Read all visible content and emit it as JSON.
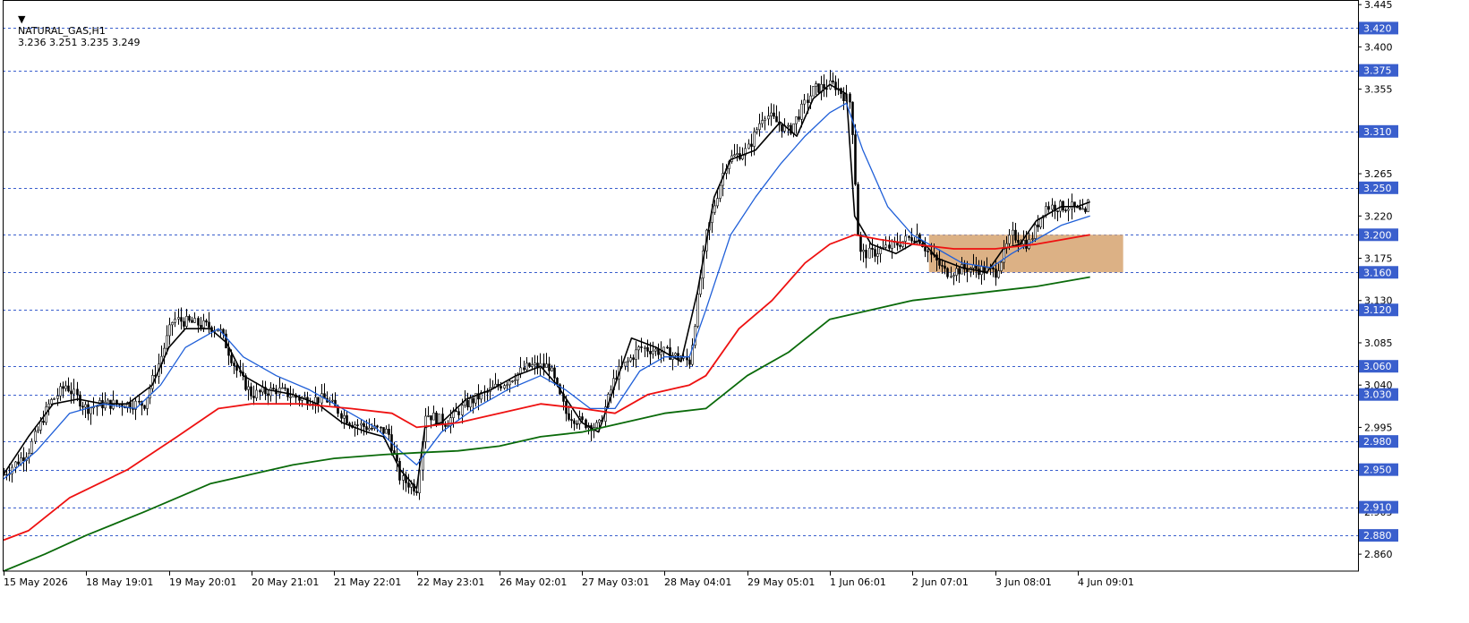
{
  "header": {
    "symbol": "NATURAL_GAS,H1",
    "ohlc": "3.236 3.251 3.235 3.249"
  },
  "colors": {
    "background": "#ffffff",
    "candles": "#000000",
    "ma_fast": "#000000",
    "ma_mid": "#1f5fd8",
    "ma_slow_red": "#ee1111",
    "ma_slowest_green": "#0a6a0a",
    "level_line": "#3a5fcd",
    "level_badge": "#3a5fcd",
    "zone_fill": "#d8a978"
  },
  "chart_data": {
    "type": "line",
    "title": "",
    "xlabel": "",
    "ylabel": "",
    "ylim": [
      2.842,
      3.448
    ],
    "y_ticks": [
      "3.445",
      "3.400",
      "3.355",
      "3.265",
      "3.220",
      "3.175",
      "3.130",
      "3.085",
      "3.040",
      "2.995",
      "2.905",
      "2.860"
    ],
    "x_ticks": [
      "15 May 2026",
      "18 May 19:01",
      "19 May 20:01",
      "20 May 21:01",
      "21 May 22:01",
      "22 May 23:01",
      "26 May 02:01",
      "27 May 03:01",
      "28 May 04:01",
      "29 May 05:01",
      "1 Jun 06:01",
      "2 Jun 07:01",
      "3 Jun 08:01",
      "4 Jun 09:01"
    ],
    "levels": [
      "3.420",
      "3.375",
      "3.310",
      "3.250",
      "3.200",
      "3.160",
      "3.120",
      "3.060",
      "3.030",
      "2.980",
      "2.950",
      "2.910",
      "2.880"
    ],
    "zone": {
      "top": 3.2,
      "bottom": 3.16,
      "x_start": 11.2,
      "x_end": 13.55
    },
    "candles_close_path": [
      [
        0,
        2.945
      ],
      [
        0.3,
        2.97
      ],
      [
        0.55,
        3.02
      ],
      [
        0.75,
        3.04
      ],
      [
        1.0,
        3.015
      ],
      [
        1.2,
        3.02
      ],
      [
        1.4,
        3.02
      ],
      [
        1.7,
        3.02
      ],
      [
        1.9,
        3.07
      ],
      [
        2.05,
        3.11
      ],
      [
        2.35,
        3.105
      ],
      [
        2.6,
        3.1
      ],
      [
        2.85,
        3.05
      ],
      [
        3.0,
        3.03
      ],
      [
        3.3,
        3.035
      ],
      [
        3.6,
        3.025
      ],
      [
        3.9,
        3.025
      ],
      [
        4.2,
        3.0
      ],
      [
        4.4,
        2.995
      ],
      [
        4.65,
        2.99
      ],
      [
        4.8,
        2.94
      ],
      [
        5.0,
        2.93
      ],
      [
        5.1,
        3.01
      ],
      [
        5.35,
        3.0
      ],
      [
        5.6,
        3.02
      ],
      [
        5.8,
        3.03
      ],
      [
        6.1,
        3.045
      ],
      [
        6.35,
        3.06
      ],
      [
        6.6,
        3.06
      ],
      [
        6.8,
        3.01
      ],
      [
        7.0,
        3.0
      ],
      [
        7.2,
        2.995
      ],
      [
        7.4,
        3.05
      ],
      [
        7.7,
        3.08
      ],
      [
        8.0,
        3.075
      ],
      [
        8.3,
        3.065
      ],
      [
        8.5,
        3.2
      ],
      [
        8.75,
        3.28
      ],
      [
        9.0,
        3.29
      ],
      [
        9.2,
        3.33
      ],
      [
        9.5,
        3.31
      ],
      [
        9.8,
        3.355
      ],
      [
        10.05,
        3.36
      ],
      [
        10.25,
        3.34
      ],
      [
        10.35,
        3.18
      ],
      [
        10.5,
        3.18
      ],
      [
        10.8,
        3.19
      ],
      [
        11.05,
        3.2
      ],
      [
        11.2,
        3.18
      ],
      [
        11.4,
        3.16
      ],
      [
        11.7,
        3.165
      ],
      [
        12.0,
        3.16
      ],
      [
        12.2,
        3.2
      ],
      [
        12.4,
        3.19
      ],
      [
        12.6,
        3.23
      ],
      [
        12.9,
        3.23
      ],
      [
        13.1,
        3.22
      ],
      [
        13.15,
        3.249
      ]
    ],
    "series": [
      {
        "values": [
          [
            0,
            2.945
          ],
          [
            0.3,
            2.985
          ],
          [
            0.6,
            3.02
          ],
          [
            0.9,
            3.025
          ],
          [
            1.2,
            3.02
          ],
          [
            1.5,
            3.02
          ],
          [
            1.8,
            3.04
          ],
          [
            2.0,
            3.08
          ],
          [
            2.2,
            3.1
          ],
          [
            2.5,
            3.1
          ],
          [
            2.7,
            3.085
          ],
          [
            2.9,
            3.05
          ],
          [
            3.2,
            3.035
          ],
          [
            3.5,
            3.03
          ],
          [
            3.8,
            3.02
          ],
          [
            4.1,
            3.0
          ],
          [
            4.4,
            2.99
          ],
          [
            4.6,
            2.985
          ],
          [
            4.8,
            2.95
          ],
          [
            5.0,
            2.93
          ],
          [
            5.1,
            2.995
          ],
          [
            5.3,
            3.0
          ],
          [
            5.6,
            3.025
          ],
          [
            5.9,
            3.035
          ],
          [
            6.2,
            3.05
          ],
          [
            6.5,
            3.06
          ],
          [
            6.7,
            3.04
          ],
          [
            7.0,
            3.0
          ],
          [
            7.2,
            2.99
          ],
          [
            7.4,
            3.04
          ],
          [
            7.6,
            3.09
          ],
          [
            7.9,
            3.08
          ],
          [
            8.2,
            3.065
          ],
          [
            8.4,
            3.14
          ],
          [
            8.6,
            3.24
          ],
          [
            8.8,
            3.28
          ],
          [
            9.1,
            3.29
          ],
          [
            9.4,
            3.32
          ],
          [
            9.6,
            3.305
          ],
          [
            9.8,
            3.345
          ],
          [
            10.0,
            3.36
          ],
          [
            10.2,
            3.35
          ],
          [
            10.3,
            3.22
          ],
          [
            10.5,
            3.19
          ],
          [
            10.8,
            3.18
          ],
          [
            11.1,
            3.195
          ],
          [
            11.3,
            3.175
          ],
          [
            11.6,
            3.165
          ],
          [
            11.9,
            3.16
          ],
          [
            12.1,
            3.185
          ],
          [
            12.3,
            3.19
          ],
          [
            12.5,
            3.215
          ],
          [
            12.8,
            3.23
          ],
          [
            13.0,
            3.23
          ],
          [
            13.15,
            3.235
          ]
        ]
      },
      {
        "values": [
          [
            0,
            2.94
          ],
          [
            0.4,
            2.97
          ],
          [
            0.8,
            3.01
          ],
          [
            1.2,
            3.02
          ],
          [
            1.6,
            3.015
          ],
          [
            1.9,
            3.04
          ],
          [
            2.2,
            3.08
          ],
          [
            2.6,
            3.1
          ],
          [
            2.9,
            3.07
          ],
          [
            3.3,
            3.05
          ],
          [
            3.7,
            3.035
          ],
          [
            4.1,
            3.015
          ],
          [
            4.5,
            2.995
          ],
          [
            4.8,
            2.97
          ],
          [
            5.0,
            2.955
          ],
          [
            5.3,
            2.99
          ],
          [
            5.7,
            3.015
          ],
          [
            6.1,
            3.035
          ],
          [
            6.5,
            3.05
          ],
          [
            6.8,
            3.035
          ],
          [
            7.1,
            3.015
          ],
          [
            7.4,
            3.015
          ],
          [
            7.7,
            3.055
          ],
          [
            8.0,
            3.07
          ],
          [
            8.3,
            3.07
          ],
          [
            8.5,
            3.12
          ],
          [
            8.8,
            3.2
          ],
          [
            9.1,
            3.24
          ],
          [
            9.4,
            3.275
          ],
          [
            9.7,
            3.305
          ],
          [
            10.0,
            3.33
          ],
          [
            10.2,
            3.34
          ],
          [
            10.4,
            3.29
          ],
          [
            10.7,
            3.23
          ],
          [
            11.0,
            3.2
          ],
          [
            11.3,
            3.185
          ],
          [
            11.6,
            3.17
          ],
          [
            11.95,
            3.165
          ],
          [
            12.2,
            3.18
          ],
          [
            12.5,
            3.195
          ],
          [
            12.8,
            3.21
          ],
          [
            13.15,
            3.22
          ]
        ]
      },
      {
        "values": [
          [
            0,
            2.875
          ],
          [
            0.3,
            2.885
          ],
          [
            0.8,
            2.92
          ],
          [
            1.5,
            2.95
          ],
          [
            2.1,
            2.985
          ],
          [
            2.6,
            3.015
          ],
          [
            3.0,
            3.02
          ],
          [
            3.6,
            3.02
          ],
          [
            4.2,
            3.015
          ],
          [
            4.7,
            3.01
          ],
          [
            5.0,
            2.995
          ],
          [
            5.5,
            3.0
          ],
          [
            6.0,
            3.01
          ],
          [
            6.5,
            3.02
          ],
          [
            7.0,
            3.015
          ],
          [
            7.4,
            3.01
          ],
          [
            7.8,
            3.03
          ],
          [
            8.3,
            3.04
          ],
          [
            8.5,
            3.05
          ],
          [
            8.9,
            3.1
          ],
          [
            9.3,
            3.13
          ],
          [
            9.7,
            3.17
          ],
          [
            10.0,
            3.19
          ],
          [
            10.3,
            3.2
          ],
          [
            10.6,
            3.195
          ],
          [
            11.0,
            3.19
          ],
          [
            11.5,
            3.185
          ],
          [
            12.0,
            3.185
          ],
          [
            12.5,
            3.19
          ],
          [
            13.15,
            3.2
          ]
        ]
      },
      {
        "values": [
          [
            0,
            2.842
          ],
          [
            0.5,
            2.86
          ],
          [
            1.0,
            2.88
          ],
          [
            1.7,
            2.905
          ],
          [
            2.5,
            2.935
          ],
          [
            3.0,
            2.945
          ],
          [
            3.5,
            2.955
          ],
          [
            4.0,
            2.962
          ],
          [
            4.6,
            2.966
          ],
          [
            5.0,
            2.968
          ],
          [
            5.5,
            2.97
          ],
          [
            6.0,
            2.975
          ],
          [
            6.5,
            2.985
          ],
          [
            7.0,
            2.99
          ],
          [
            7.5,
            3.0
          ],
          [
            8.0,
            3.01
          ],
          [
            8.5,
            3.015
          ],
          [
            9.0,
            3.05
          ],
          [
            9.5,
            3.075
          ],
          [
            10.0,
            3.11
          ],
          [
            10.5,
            3.12
          ],
          [
            11.0,
            3.13
          ],
          [
            11.5,
            3.135
          ],
          [
            12.0,
            3.14
          ],
          [
            12.5,
            3.145
          ],
          [
            13.15,
            3.155
          ]
        ]
      }
    ]
  }
}
